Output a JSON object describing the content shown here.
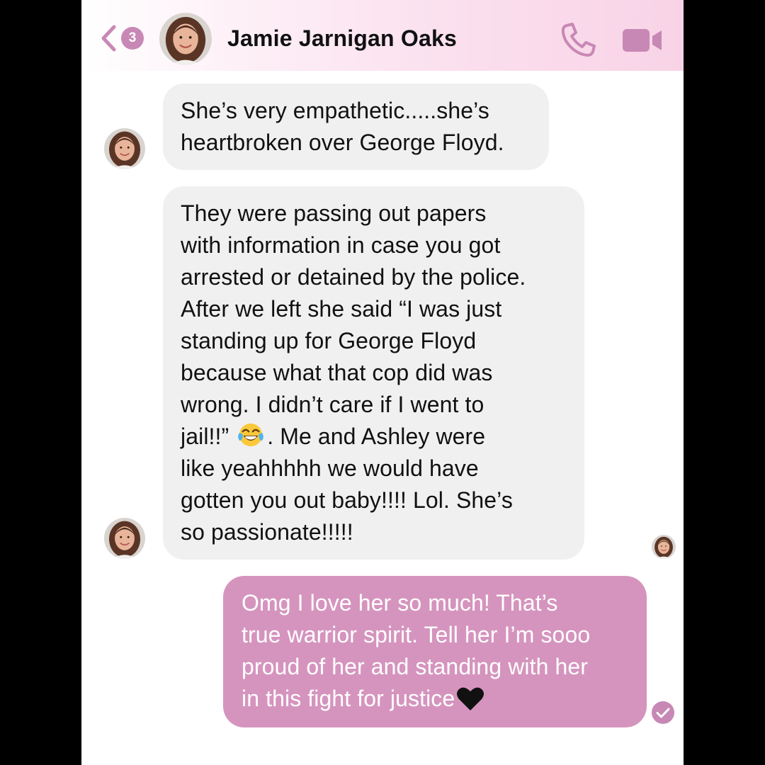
{
  "header": {
    "back_badge": "3",
    "contact_name": "Jamie Jarnigan Oaks",
    "icons": {
      "back": "chevron-left-icon",
      "call": "phone-icon",
      "video": "video-camera-icon"
    }
  },
  "messages": [
    {
      "direction": "incoming",
      "lines": [
        "She’s very empathetic.....she’s",
        "heartbroken over George Floyd."
      ]
    },
    {
      "direction": "incoming",
      "lines": [
        "They were passing out papers",
        "with information in case you got",
        "arrested or detained by the police.",
        "After we left she said “I was just",
        "standing up for George Floyd",
        "because what that cop did was",
        "wrong.  I didn’t care if I went to",
        "jail!!”",
        ".  Me and Ashley were",
        "like yeahhhhh we would have",
        "gotten you out baby!!!!  Lol.  She’s",
        "so passionate!!!!!"
      ],
      "emoji": "face-with-tears-of-joy-icon"
    },
    {
      "direction": "outgoing",
      "lines": [
        "Omg I love her so much! That’s",
        "true warrior spirit. Tell her I’m sooo",
        "proud of her and standing with her",
        "in this fight for justice"
      ],
      "emoji": "black-heart-icon"
    }
  ],
  "colors": {
    "outgoing_bubble": "#d594be",
    "incoming_bubble": "#f0f0f0",
    "accent": "#c888b5",
    "header_gradient_end": "#f8d3e6"
  },
  "status": {
    "sent_icon": "check-circle-icon",
    "seen_icon": "avatar-read-receipt"
  }
}
